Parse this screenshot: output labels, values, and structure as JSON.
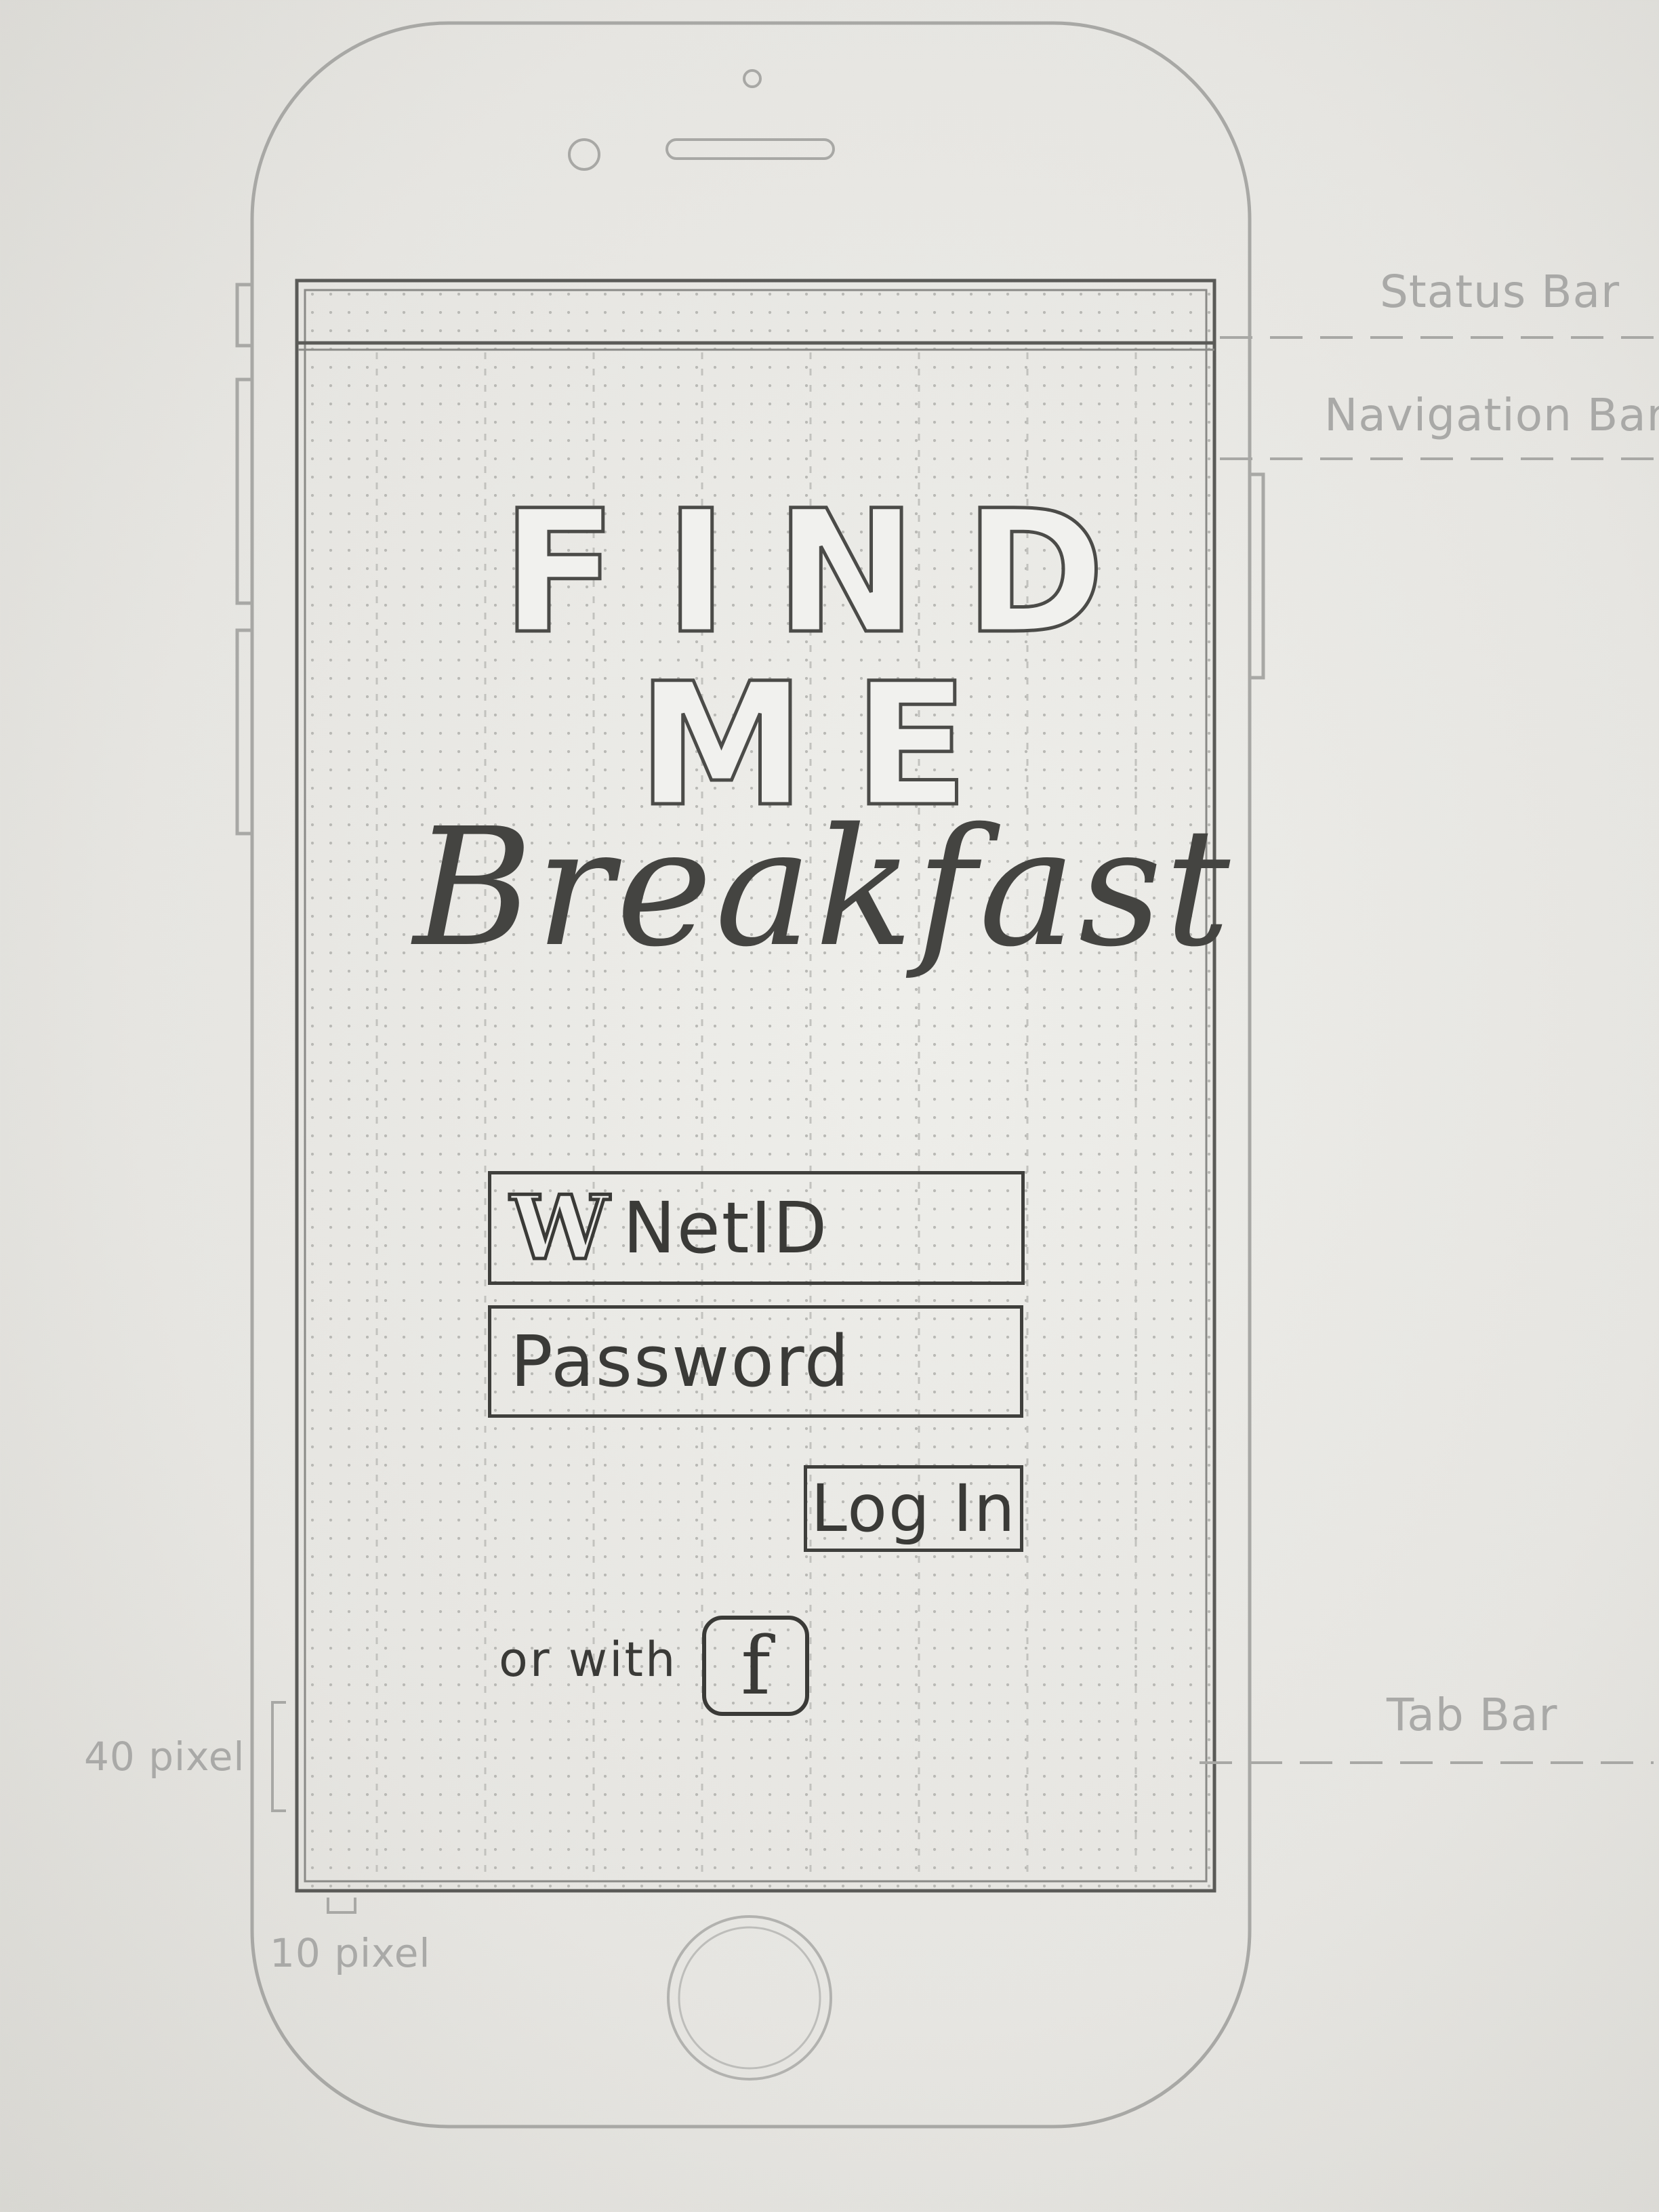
{
  "annotations": {
    "status_bar": "Status Bar",
    "navigation_bar": "Navigation Bar",
    "tab_bar": "Tab Bar",
    "side_margin": "40 pixel",
    "bottom_margin": "10 pixel"
  },
  "app": {
    "title_line1": "FIND",
    "title_line2": "ME",
    "title_line3": "Breakfast"
  },
  "login": {
    "netid_logo": "W",
    "netid_label": "NetID",
    "password_label": "Password",
    "login_button": "Log In",
    "or_with_label": "or with",
    "facebook_glyph": "f"
  }
}
